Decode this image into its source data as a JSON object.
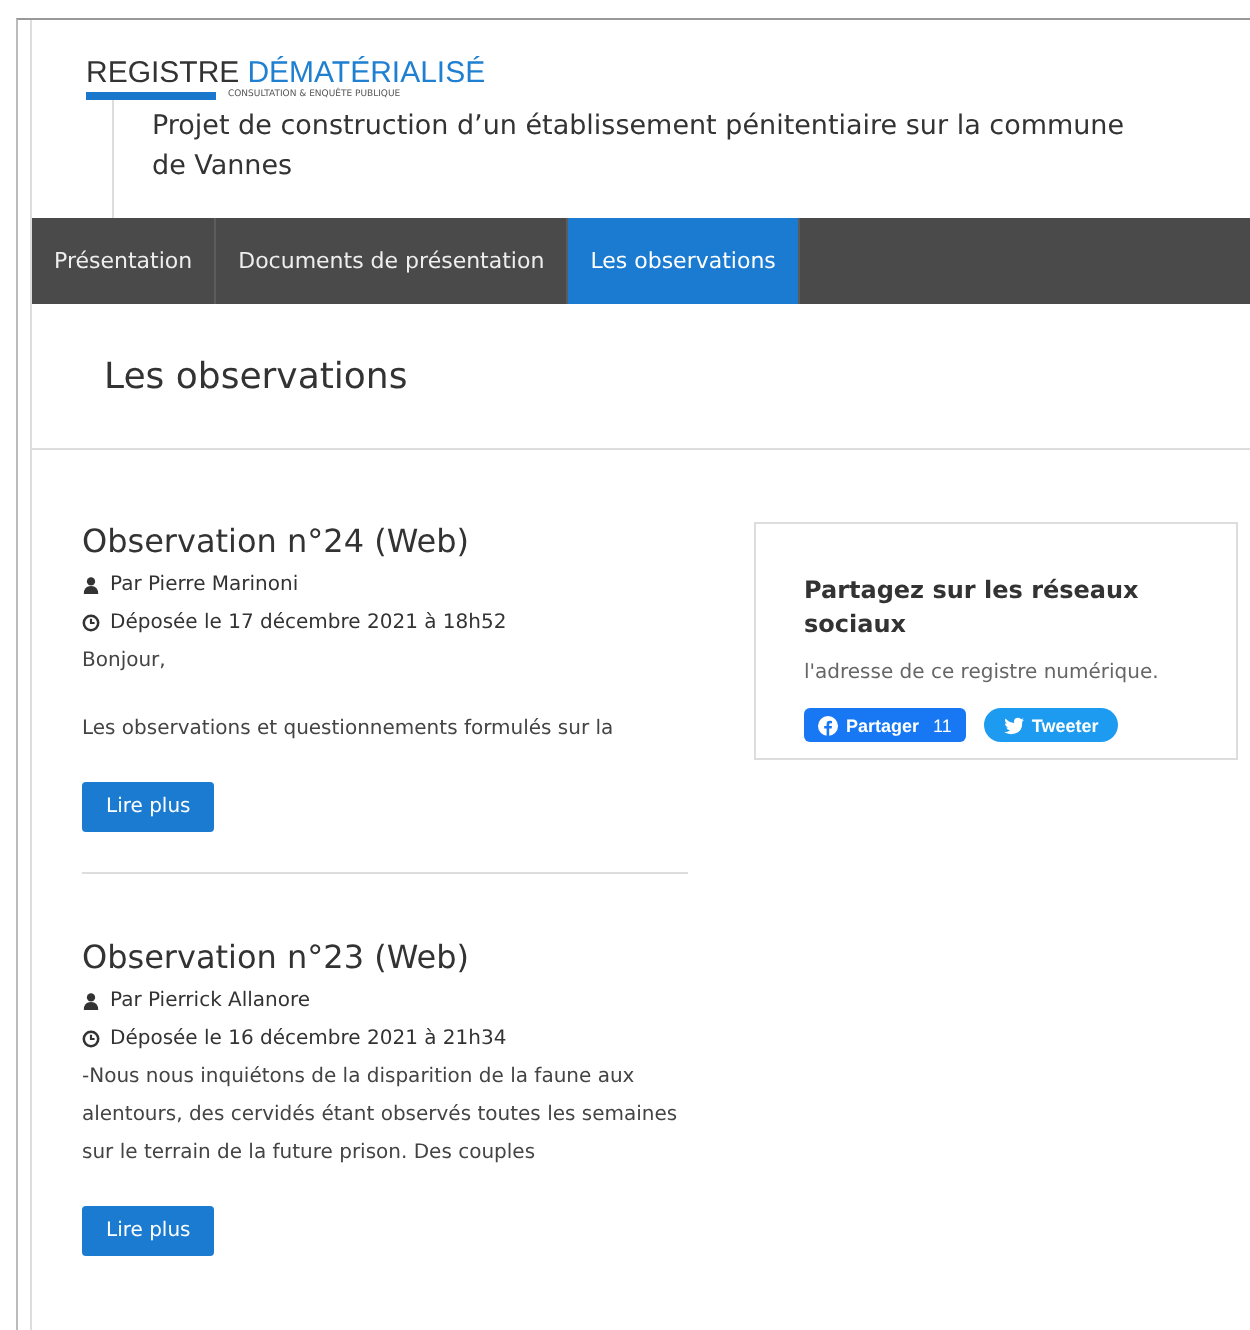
{
  "logo": {
    "word_1": "REGISTRE",
    "word_2": "DÉMATÉRIALISÉ",
    "tagline": "CONSULTATION & ENQUÊTE PUBLIQUE"
  },
  "project_title": "Projet de construction d’un établissement pénitentiaire sur la commune de Vannes",
  "tabs": [
    {
      "label": "Présentation",
      "selected": false
    },
    {
      "label": "Documents de présentation",
      "selected": false
    },
    {
      "label": "Les observations",
      "selected": true
    }
  ],
  "page_heading": "Les observations",
  "observations": [
    {
      "title": "Observation n°24 (Web)",
      "author": "Par Pierre Marinoni",
      "date": "Déposée le 17 décembre 2021 à 18h52",
      "paragraphs": [
        "Bonjour,",
        "Les observations et questionnements formulés sur la"
      ],
      "button": "Lire plus"
    },
    {
      "title": "Observation n°23 (Web)",
      "author": "Par Pierrick Allanore",
      "date": "Déposée le 16 décembre 2021 à 21h34",
      "paragraphs": [
        "-Nous nous inquiétons de la disparition de la faune aux alentours, des cervidés étant observés toutes les semaines sur le terrain de la future prison. Des couples"
      ],
      "button": "Lire plus"
    }
  ],
  "share": {
    "title": "Partagez sur les réseaux sociaux",
    "text": "l'adresse de ce registre numérique.",
    "buttons": [
      {
        "kind": "facebook",
        "label": "Partager",
        "count": "11"
      },
      {
        "kind": "twitter",
        "label": "Tweeter"
      }
    ]
  }
}
